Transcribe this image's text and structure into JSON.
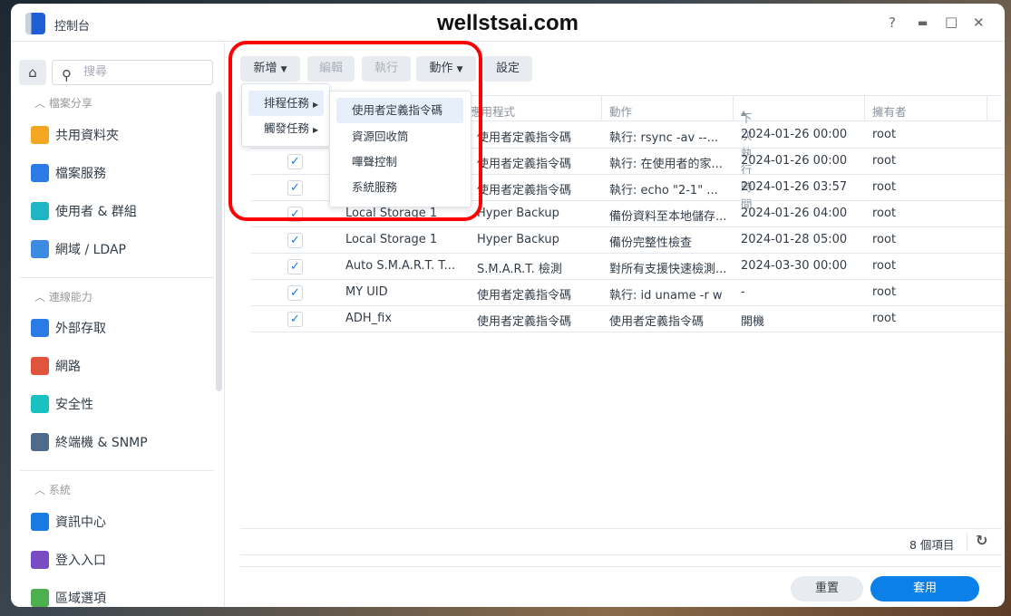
{
  "window": {
    "title": "控制台",
    "watermark": "wellstsai.com",
    "help": "?",
    "maximize": "□",
    "close": "✕",
    "minimize": "▬"
  },
  "sidebar": {
    "search_placeholder": "搜尋",
    "sections": [
      {
        "label": "檔案分享",
        "items": [
          {
            "label": "共用資料夾",
            "icon": "folder-icon",
            "color": "#f5a623"
          },
          {
            "label": "檔案服務",
            "icon": "file-services-icon",
            "color": "#2a7be4"
          },
          {
            "label": "使用者 & 群組",
            "icon": "users-icon",
            "color": "#1fb5c4"
          },
          {
            "label": "網域 / LDAP",
            "icon": "domain-icon",
            "color": "#3d8be0"
          }
        ]
      },
      {
        "label": "連線能力",
        "items": [
          {
            "label": "外部存取",
            "icon": "external-access-icon",
            "color": "#2a7be4"
          },
          {
            "label": "網路",
            "icon": "network-icon",
            "color": "#e0533c"
          },
          {
            "label": "安全性",
            "icon": "shield-icon",
            "color": "#19c1c1"
          },
          {
            "label": "終端機 & SNMP",
            "icon": "terminal-icon",
            "color": "#4e6b8c"
          }
        ]
      },
      {
        "label": "系統",
        "items": [
          {
            "label": "資訊中心",
            "icon": "info-icon",
            "color": "#1a7be0"
          },
          {
            "label": "登入入口",
            "icon": "login-portal-icon",
            "color": "#7a4cc4"
          },
          {
            "label": "區域選項",
            "icon": "regional-icon",
            "color": "#4caf50"
          }
        ]
      }
    ]
  },
  "toolbar": {
    "create": "新增",
    "edit": "編輯",
    "run": "執行",
    "action": "動作",
    "settings": "設定"
  },
  "create_menu": {
    "items": [
      "排程任務",
      "觸發任務"
    ]
  },
  "scheduled_submenu": {
    "items": [
      "使用者定義指令碼",
      "資源回收筒",
      "嗶聲控制",
      "系統服務"
    ]
  },
  "table": {
    "columns": [
      "應用程式",
      "動作",
      "下次執行時間",
      "擁有者"
    ],
    "rows": [
      {
        "enabled": true,
        "name": "",
        "app": "使用者定義指令碼",
        "action": "執行: rsync -av --...",
        "next": "2024-01-26 00:00",
        "owner": "root"
      },
      {
        "enabled": true,
        "name": "",
        "app": "使用者定義指令碼",
        "action": "執行: 在使用者的家...",
        "next": "2024-01-26 00:00",
        "owner": "root"
      },
      {
        "enabled": true,
        "name": "",
        "app": "使用者定義指令碼",
        "action": "執行: echo \"2-1\" ...",
        "next": "2024-01-26 03:57",
        "owner": "root"
      },
      {
        "enabled": true,
        "name": "Local Storage 1",
        "app": "Hyper Backup",
        "action": "備份資料至本地儲存...",
        "next": "2024-01-26 04:00",
        "owner": "root"
      },
      {
        "enabled": true,
        "name": "Local Storage 1",
        "app": "Hyper Backup",
        "action": "備份完整性檢查",
        "next": "2024-01-28 05:00",
        "owner": "root"
      },
      {
        "enabled": true,
        "name": "Auto S.M.A.R.T. T...",
        "app": "S.M.A.R.T. 檢測",
        "action": "對所有支援快速檢測...",
        "next": "2024-03-30 00:00",
        "owner": "root"
      },
      {
        "enabled": true,
        "name": "MY UID",
        "app": "使用者定義指令碼",
        "action": "執行: id uname -r w",
        "next": "-",
        "owner": "root"
      },
      {
        "enabled": true,
        "name": "ADH_fix",
        "app": "使用者定義指令碼",
        "action": "使用者定義指令碼",
        "next": "開機",
        "owner": "root"
      }
    ]
  },
  "footer": {
    "count": "8 個項目",
    "reset": "重置",
    "apply": "套用"
  },
  "colors": {
    "accent": "#0a80e8",
    "highlight": "#f00"
  }
}
